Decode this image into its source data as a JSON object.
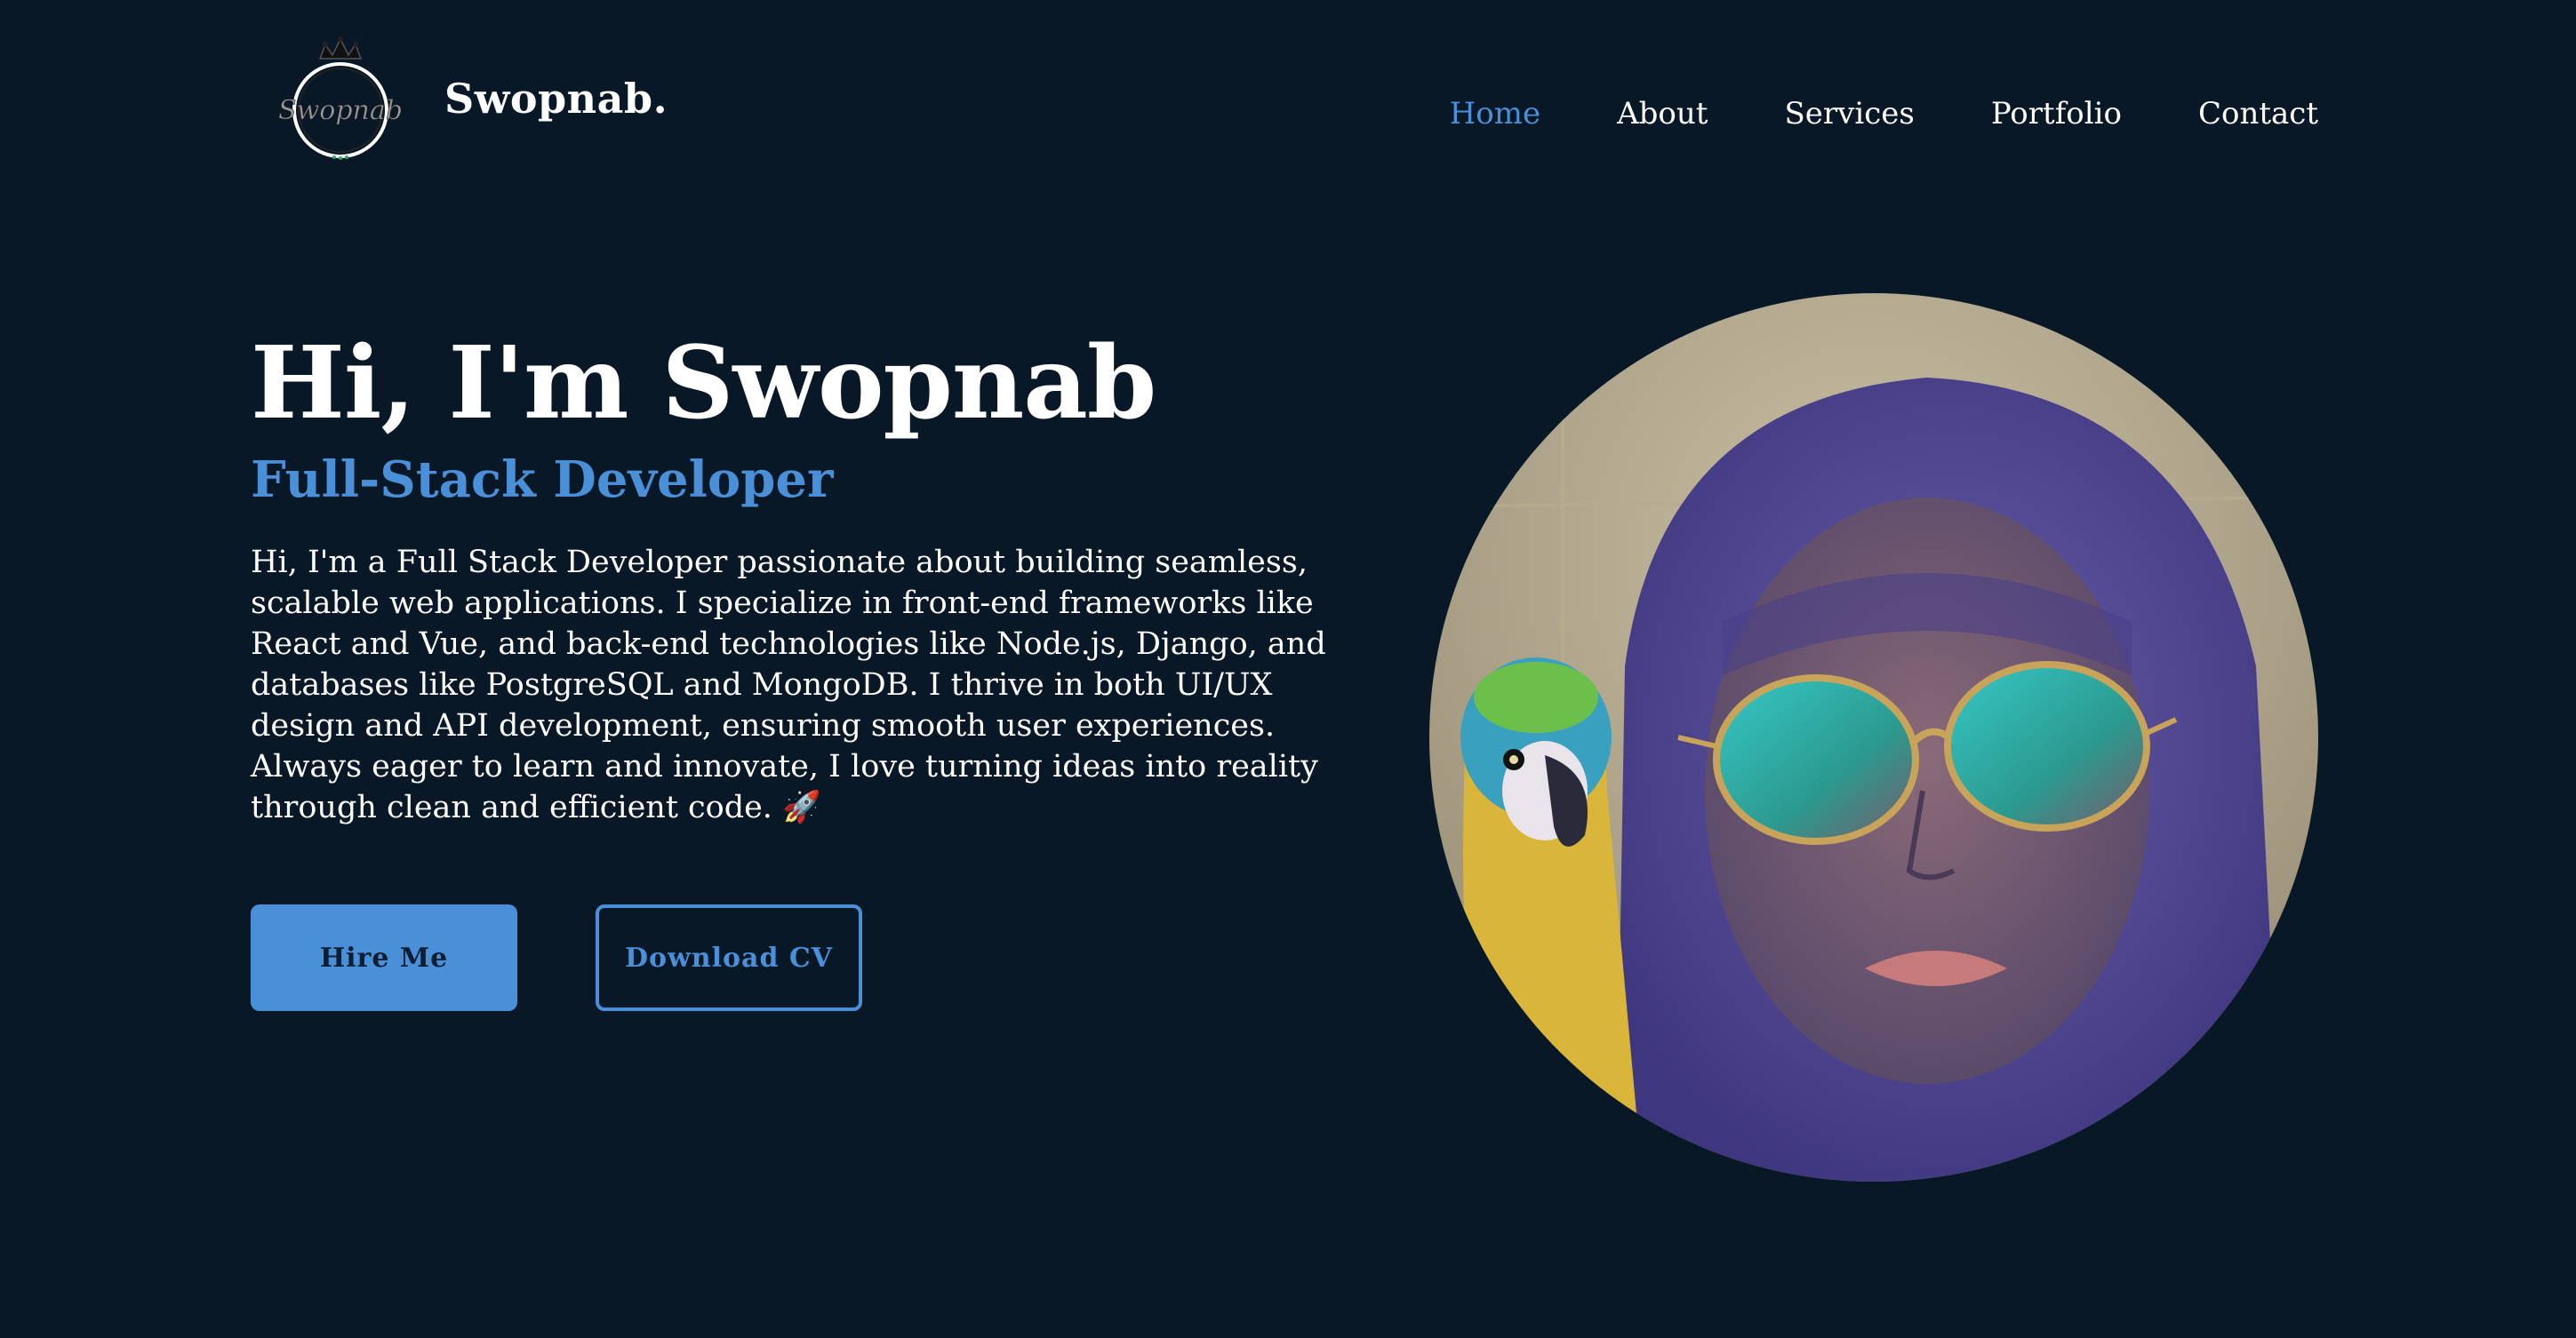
{
  "brand": {
    "logo_text": "Swopnab",
    "name": "Swopnab."
  },
  "nav": {
    "items": [
      {
        "label": "Home",
        "active": true
      },
      {
        "label": "About",
        "active": false
      },
      {
        "label": "Services",
        "active": false
      },
      {
        "label": "Portfolio",
        "active": false
      },
      {
        "label": "Contact",
        "active": false
      }
    ]
  },
  "hero": {
    "title": "Hi, I'm Swopnab",
    "subtitle": "Full-Stack Developer",
    "description": "Hi, I'm a Full Stack Developer passionate about building seamless, scalable web applications. I specialize in front-end frameworks like React and Vue, and back-end technologies like Node.js, Django, and databases like PostgreSQL and MongoDB. I thrive in both UI/UX design and API development, ensuring smooth user experiences. Always eager to learn and innovate, I love turning ideas into reality through clean and efficient code. 🚀",
    "hire_label": "Hire Me",
    "cv_label": "Download CV"
  },
  "colors": {
    "background": "#081827",
    "accent": "#4a90d9",
    "text": "#ffffff"
  },
  "icons": {
    "logo": "crown-signature-logo",
    "photo": "profile-photo-with-parrot"
  }
}
